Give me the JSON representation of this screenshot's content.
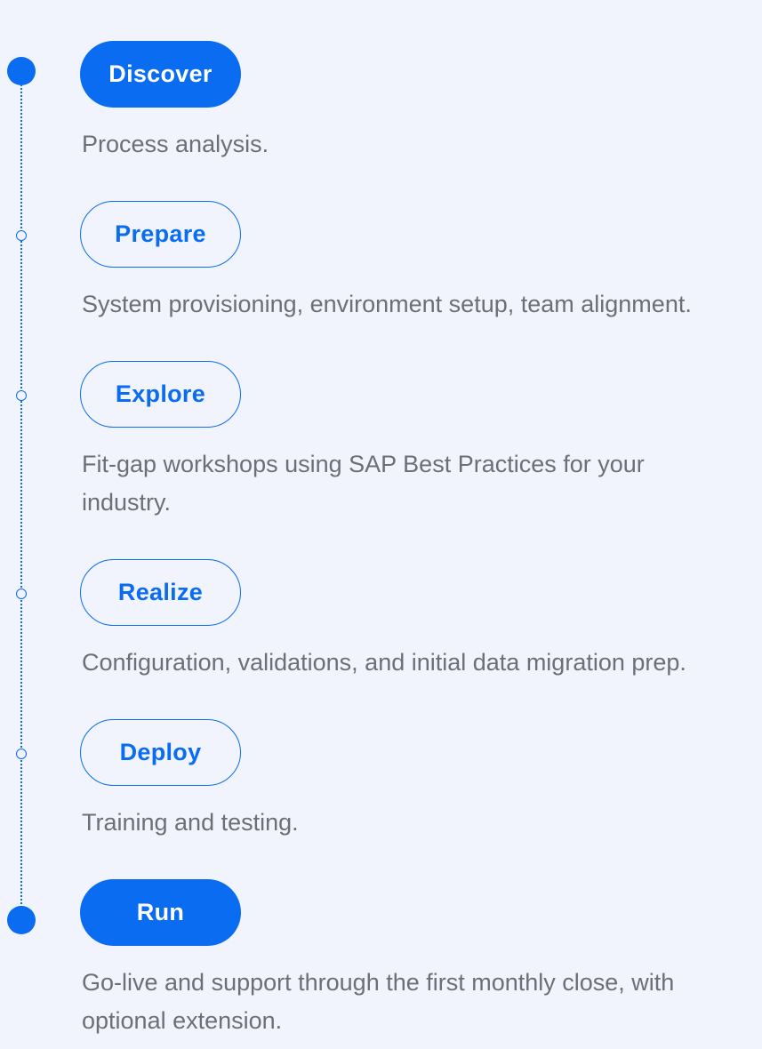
{
  "colors": {
    "background": "#f1f4fd",
    "accent": "#0a6cf0",
    "text_muted": "#6b6f78"
  },
  "steps": [
    {
      "label": "Discover",
      "description": "Process analysis.",
      "style": "filled"
    },
    {
      "label": "Prepare",
      "description": "System provisioning, environment setup, team alignment.",
      "style": "outline"
    },
    {
      "label": "Explore",
      "description": "Fit-gap workshops using SAP Best Practices for your industry.",
      "style": "outline"
    },
    {
      "label": "Realize",
      "description": "Configuration, validations, and initial data migration prep.",
      "style": "outline"
    },
    {
      "label": "Deploy",
      "description": "Training and testing.",
      "style": "outline"
    },
    {
      "label": "Run",
      "description": "Go-live and support through the first monthly close, with optional extension.",
      "style": "filled"
    }
  ]
}
